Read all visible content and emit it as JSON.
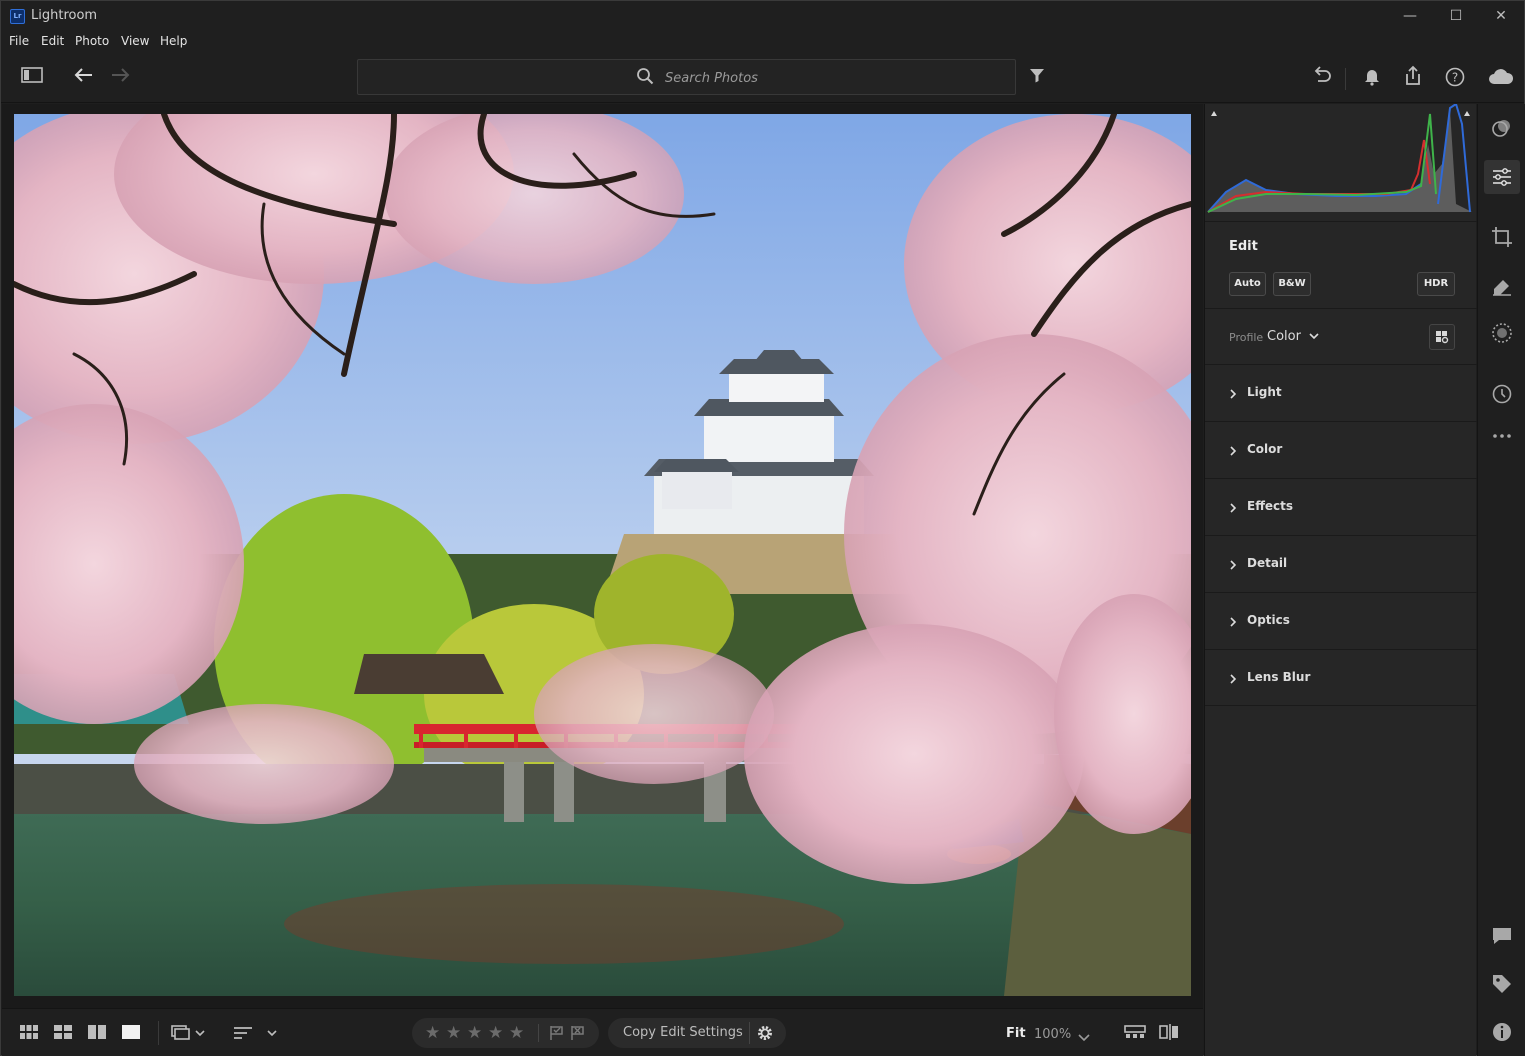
{
  "window": {
    "app_icon_text": "Lr",
    "title": "Lightroom",
    "controls": {
      "minimize": "—",
      "maximize": "☐",
      "close": "✕"
    }
  },
  "menubar": {
    "items": [
      {
        "label": "File"
      },
      {
        "label": "Edit"
      },
      {
        "label": "Photo"
      },
      {
        "label": "View"
      },
      {
        "label": "Help"
      }
    ]
  },
  "toolbar": {
    "search_placeholder": "Search Photos",
    "icons": [
      "sidebar-toggle-icon",
      "back-arrow-icon",
      "forward-arrow-icon",
      "filter-icon",
      "undo-icon",
      "bell-icon",
      "share-icon",
      "help-icon",
      "cloud-icon"
    ]
  },
  "photo": {
    "description_icon": "photo"
  },
  "edit_panel": {
    "title": "Edit",
    "buttons": {
      "auto": "Auto",
      "bw": "B&W",
      "hdr": "HDR"
    },
    "profile_label": "Profile",
    "profile_value": "Color",
    "sections": [
      {
        "label": "Light"
      },
      {
        "label": "Color"
      },
      {
        "label": "Effects"
      },
      {
        "label": "Detail"
      },
      {
        "label": "Optics"
      },
      {
        "label": "Lens Blur"
      }
    ]
  },
  "bottombar": {
    "rating_stars": [
      "★",
      "★",
      "★",
      "★",
      "★"
    ],
    "copy_edit_settings": "Copy Edit Settings",
    "fit": "Fit",
    "zoom": "100%"
  },
  "colors": {
    "background": "#1e1e1e",
    "panel": "#262626",
    "accent_lr": "#2f6fd9"
  }
}
